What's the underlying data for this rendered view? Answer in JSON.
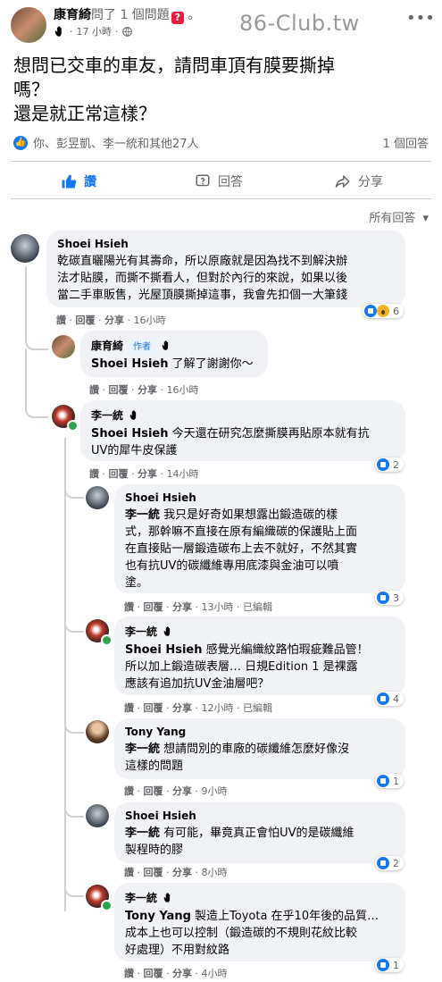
{
  "post": {
    "author": "康育綺",
    "author_suffix": "問了 1 個問題",
    "question_badge": "?",
    "time": "17 小時",
    "watermark": "86-Club.tw",
    "text": [
      "想問已交車的車友，請問車頂有膜要撕掉",
      "嗎？",
      "還是就正常這樣？"
    ],
    "reactions_text": "你、彭昱凱、李一統和其他27人",
    "answers_count": "1 個回答",
    "actions": {
      "like": "讚",
      "answer": "回答",
      "share": "分享"
    },
    "sort_label": "所有回答"
  },
  "comments": [
    {
      "name": "Shoei Hsieh",
      "lines": [
        "乾碳直曬陽光有其壽命，所以原廠就是因為找不到解決辦",
        "法才貼膜，而撕不撕看人，但對於內行的來說，如果以後",
        "當二手車販售，光屋頂膜撕掉這事，我會先扣個一大筆錢"
      ],
      "foot": [
        "讚",
        "回覆",
        "分享",
        "16小時"
      ],
      "count": "6"
    },
    {
      "name": "康育綺",
      "author_tag": "作者",
      "mention": "Shoei Hsieh",
      "lines": [
        " 了解了謝謝你～"
      ],
      "foot": [
        "讚",
        "回覆",
        "分享",
        "16小時"
      ]
    },
    {
      "name": "李一統",
      "mention": "Shoei Hsieh",
      "lines": [
        " 今天還在研究怎麼撕膜再貼原本就有抗",
        "UV的犀牛皮保護"
      ],
      "foot": [
        "讚",
        "回覆",
        "分享",
        "14小時"
      ],
      "count": "2"
    },
    {
      "name": "Shoei Hsieh",
      "mention": "李一統",
      "lines": [
        " 我只是好奇如果想露出鍛造碳的樣",
        "式，那幹嘛不直接在原有編織碳的保護貼上面",
        "在直接貼一層鍛造碳布上去不就好，不然其實",
        "也有抗UV的碳纖維專用底漆與金油可以噴",
        "塗。"
      ],
      "foot": [
        "讚",
        "回覆",
        "分享",
        "13小時",
        "已編輯"
      ],
      "count": "3"
    },
    {
      "name": "李一統",
      "mention": "Shoei Hsieh",
      "lines": [
        " 感覺光編織紋路怕瑕疵難品管！",
        "所以加上鍛造碳表層… 日規Edition 1 是裸露",
        "應該有追加抗UV金油層吧？"
      ],
      "foot": [
        "讚",
        "回覆",
        "分享",
        "12小時",
        "已編輯"
      ],
      "count": "4"
    },
    {
      "name": "Tony Yang",
      "mention": "李一統",
      "lines": [
        " 想請問別的車廠的碳纖維怎麼好像沒",
        "這樣的問題"
      ],
      "foot": [
        "讚",
        "回覆",
        "分享",
        "9小時"
      ],
      "count": "1"
    },
    {
      "name": "Shoei Hsieh",
      "mention": "李一統",
      "lines": [
        " 有可能，畢竟真正會怕UV的是碳纖維",
        "製程時的膠"
      ],
      "foot": [
        "讚",
        "回覆",
        "分享",
        "8小時"
      ],
      "count": "2"
    },
    {
      "name": "李一統",
      "mention": "Tony Yang",
      "lines": [
        " 製造上Toyota 在乎10年後的品質…",
        "成本上也可以控制（鍛造碳的不規則花紋比較",
        "好處理）不用對紋路"
      ],
      "foot": [
        "讚",
        "回覆",
        "分享",
        "4小時"
      ],
      "count": "1"
    }
  ],
  "colors": {
    "like_blue": "#1877f2",
    "muted": "#65676b",
    "bubble": "#f0f2f5"
  },
  "icons": [
    "waving-hand-icon",
    "globe-icon",
    "more-dots-icon",
    "like-icon",
    "answer-icon",
    "share-icon",
    "chevron-down-icon"
  ]
}
